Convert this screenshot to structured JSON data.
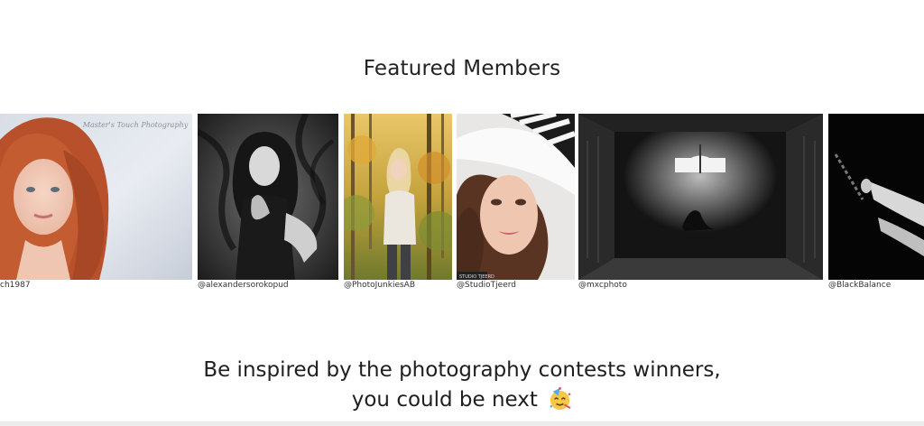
{
  "featured": {
    "title": "Featured Members"
  },
  "members": [
    {
      "handle": "ch1987",
      "watermark": "Master's Touch Photography",
      "alt": "portrait-redhead"
    },
    {
      "handle": "@alexandersorokopud",
      "alt": "bw-curly-hair-woman"
    },
    {
      "handle": "@PhotoJunkiesAB",
      "alt": "autumn-forest-blonde"
    },
    {
      "handle": "@StudioTjeerd",
      "watermark": "STUDIO TJEERD",
      "alt": "striped-hat-woman"
    },
    {
      "handle": "@mxcphoto",
      "alt": "dark-wooden-room"
    },
    {
      "handle": "@BlackBalance",
      "alt": "bw-hands-chain"
    }
  ],
  "cta": {
    "line1": "Be inspired by the photography contests winners,",
    "line2": "you could be next",
    "emoji_icon": "party-face-icon"
  },
  "colors": {
    "text": "#1f1f1f",
    "background": "#ffffff"
  }
}
